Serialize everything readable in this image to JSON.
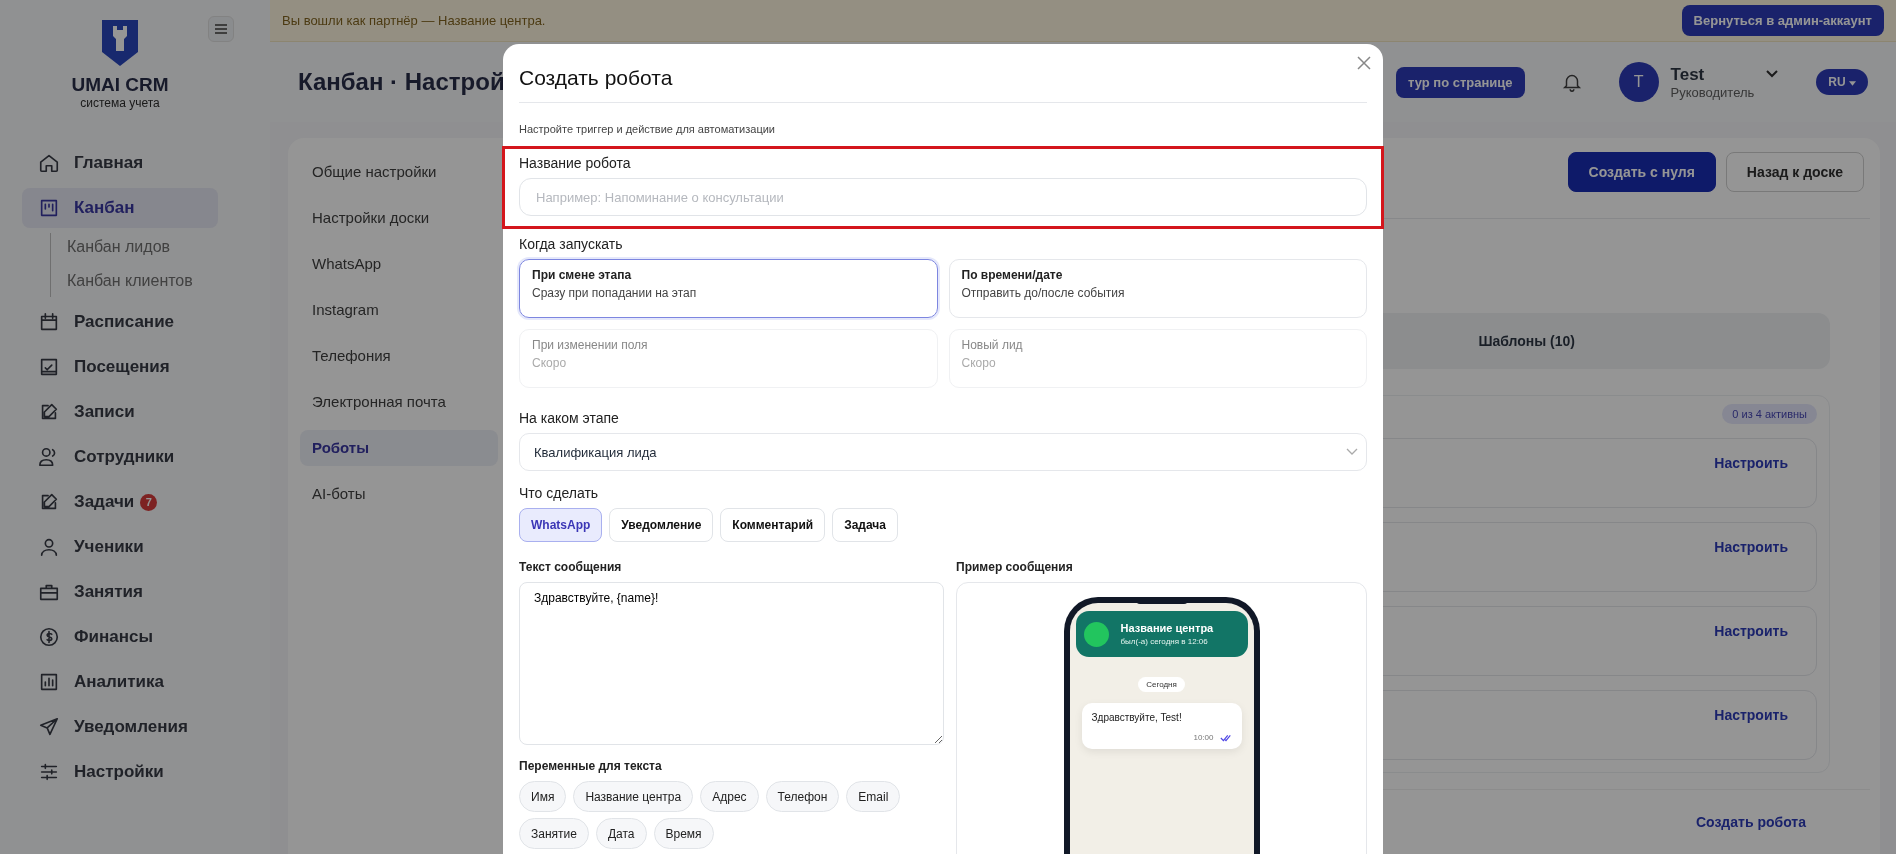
{
  "banner": {
    "text": "Вы вошли как партнёр — Название центра.",
    "button": "Вернуться в админ-аккаунт"
  },
  "brand": {
    "name": "UMAI CRM",
    "tagline": "система учета"
  },
  "sidebar": {
    "items": [
      {
        "label": "Главная",
        "selected": false
      },
      {
        "label": "Канбан",
        "selected": true,
        "children": [
          {
            "label": "Канбан лидов",
            "selected": false
          },
          {
            "label": "Канбан клиентов",
            "selected": false
          }
        ]
      },
      {
        "label": "Расписание",
        "selected": false
      },
      {
        "label": "Посещения",
        "selected": false
      },
      {
        "label": "Записи",
        "selected": false
      },
      {
        "label": "Сотрудники",
        "selected": false
      },
      {
        "label": "Задачи",
        "selected": false,
        "badge": "7"
      },
      {
        "label": "Ученики",
        "selected": false
      },
      {
        "label": "Занятия",
        "selected": false
      },
      {
        "label": "Финансы",
        "selected": false
      },
      {
        "label": "Аналитика",
        "selected": false
      },
      {
        "label": "Уведомления",
        "selected": false
      },
      {
        "label": "Настройки",
        "selected": false
      }
    ]
  },
  "header": {
    "title": "Канбан · Настрой",
    "tour_button": "тур по странице",
    "user": {
      "initial": "T",
      "name": "Test",
      "role": "Руководитель"
    },
    "language": "RU"
  },
  "settings_nav": {
    "items": [
      {
        "label": "Общие настройки",
        "selected": false
      },
      {
        "label": "Настройки доски",
        "selected": false
      },
      {
        "label": "WhatsApp",
        "selected": false
      },
      {
        "label": "Instagram",
        "selected": false
      },
      {
        "label": "Телефония",
        "selected": false
      },
      {
        "label": "Электронная почта",
        "selected": false
      },
      {
        "label": "Роботы",
        "selected": true
      },
      {
        "label": "AI-боты",
        "selected": false
      }
    ]
  },
  "robots_panel": {
    "buttons": [
      {
        "label": "Создать с нуля",
        "kind": "primary"
      },
      {
        "label": "Назад к доске",
        "kind": "secondary"
      }
    ],
    "tab": "Шаблоны (10)",
    "badge": "0 из 4 активны",
    "rows": [
      {
        "link": "Настроить"
      },
      {
        "link": "Настроить"
      },
      {
        "link": "Настроить"
      },
      {
        "link": "Настроить"
      }
    ],
    "create_link": "Создать робота"
  },
  "modal": {
    "title": "Создать робота",
    "subtitle": "Настройте триггер и действие для автоматизации",
    "name_field": {
      "label": "Название робота",
      "placeholder": "Например: Напоминание о консультации",
      "highlighted": true
    },
    "trigger": {
      "label": "Когда запускать",
      "options": [
        {
          "title": "При смене этапа",
          "description": "Сразу при попадании на этап",
          "selected": true,
          "disabled": false
        },
        {
          "title": "По времени/дате",
          "description": "Отправить до/после события",
          "selected": false,
          "disabled": false
        },
        {
          "title": "При изменении поля",
          "description": "Скоро",
          "selected": false,
          "disabled": true
        },
        {
          "title": "Новый лид",
          "description": "Скоро",
          "selected": false,
          "disabled": true
        }
      ]
    },
    "stage": {
      "label": "На каком этапе",
      "value": "Квалификация лида"
    },
    "action": {
      "label": "Что сделать",
      "options": [
        {
          "label": "WhatsApp",
          "selected": true
        },
        {
          "label": "Уведомление",
          "selected": false
        },
        {
          "label": "Комментарий",
          "selected": false
        },
        {
          "label": "Задача",
          "selected": false
        }
      ]
    },
    "message": {
      "label": "Текст сообщения",
      "value": "Здравствуйте, {name}!"
    },
    "variables": {
      "label": "Переменные для текста",
      "items": [
        "Имя",
        "Название центра",
        "Адрес",
        "Телефон",
        "Email",
        "Занятие",
        "Дата",
        "Время"
      ]
    },
    "preview": {
      "label": "Пример сообщения",
      "contact": "Название центра",
      "status": "был(-а) сегодня в 12:06",
      "day": "Сегодня",
      "message": "Здравствуйте, Test!",
      "time": "10:00"
    }
  }
}
